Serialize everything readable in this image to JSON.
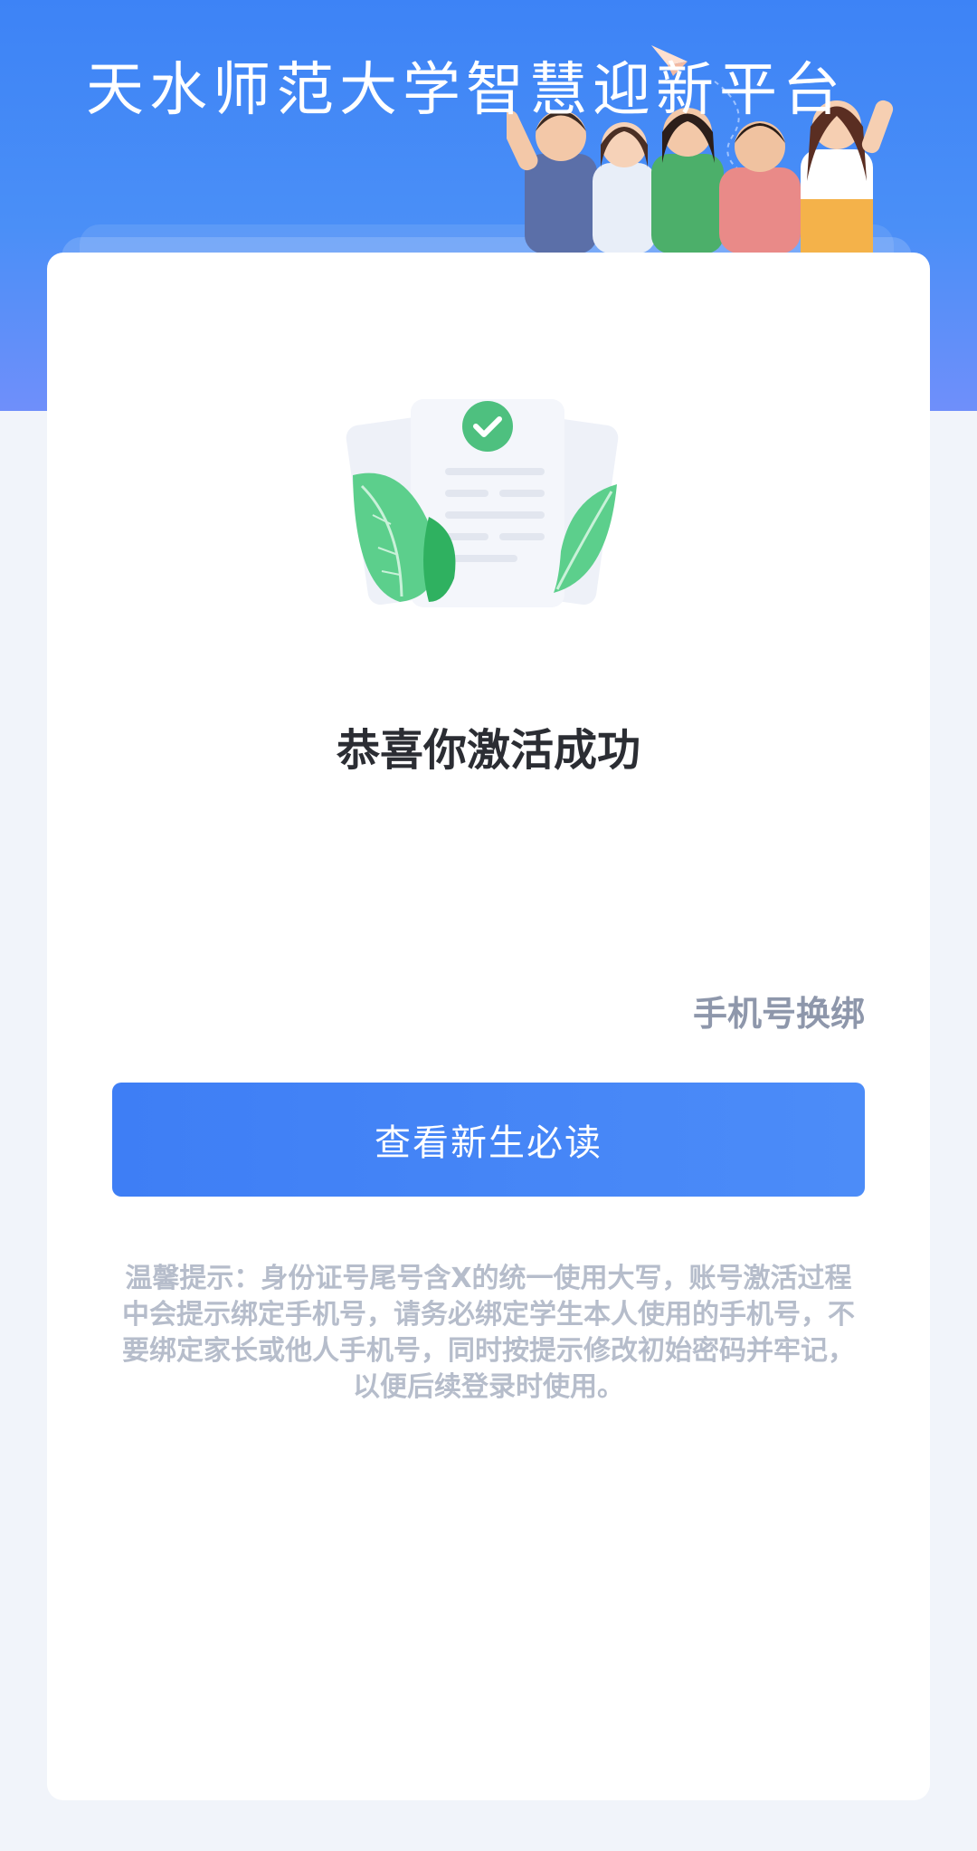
{
  "header": {
    "title": "天水师范大学智慧迎新平台",
    "illustration": "students-group-illustration"
  },
  "card": {
    "illustration": "document-check-with-leaves-illustration",
    "success_title": "恭喜你激活成功",
    "rebind_link": "手机号换绑",
    "primary_button": "查看新生必读",
    "tip": "温馨提示：身份证号尾号含X的统一使用大写，账号激活过程中会提示绑定手机号，请务必绑定学生本人使用的手机号，不要绑定家长或他人手机号，同时按提示修改初始密码并牢记，以便后续登录时使用。"
  },
  "colors": {
    "header_gradient_top": "#3d83f6",
    "header_gradient_bottom": "#6f8ffa",
    "button_blue": "#4285f4",
    "check_green": "#4ec07f",
    "muted_text": "#b6bdcb"
  }
}
